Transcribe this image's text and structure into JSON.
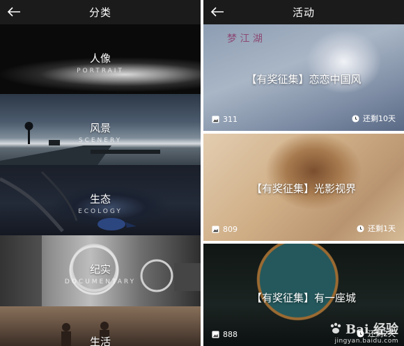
{
  "left_panel": {
    "title": "分类",
    "categories": [
      {
        "name": "人像",
        "sub": "PORTRAIT"
      },
      {
        "name": "风景",
        "sub": "SCENERY"
      },
      {
        "name": "生态",
        "sub": "ECOLOGY"
      },
      {
        "name": "纪实",
        "sub": "DOCUMENTARY"
      },
      {
        "name": "生活",
        "sub": ""
      }
    ]
  },
  "right_panel": {
    "title": "活动",
    "activities": [
      {
        "title": "【有奖征集】恋恋中国风",
        "count": "311",
        "remaining": "还剩10天",
        "calligraphy": "梦 江 湖"
      },
      {
        "title": "【有奖征集】光影视界",
        "count": "809",
        "remaining": "还剩1天"
      },
      {
        "title": "【有奖征集】有一座城",
        "count": "888",
        "remaining": "还剩2天"
      }
    ]
  },
  "icons": {
    "back": "back-arrow-icon",
    "photos": "photos-icon",
    "clock": "clock-icon"
  },
  "watermark": {
    "brand": "Bai 经验",
    "url": "jingyan.baidu.com"
  },
  "colors": {
    "topbar": "#1b1b1b",
    "text": "#ffffff"
  }
}
